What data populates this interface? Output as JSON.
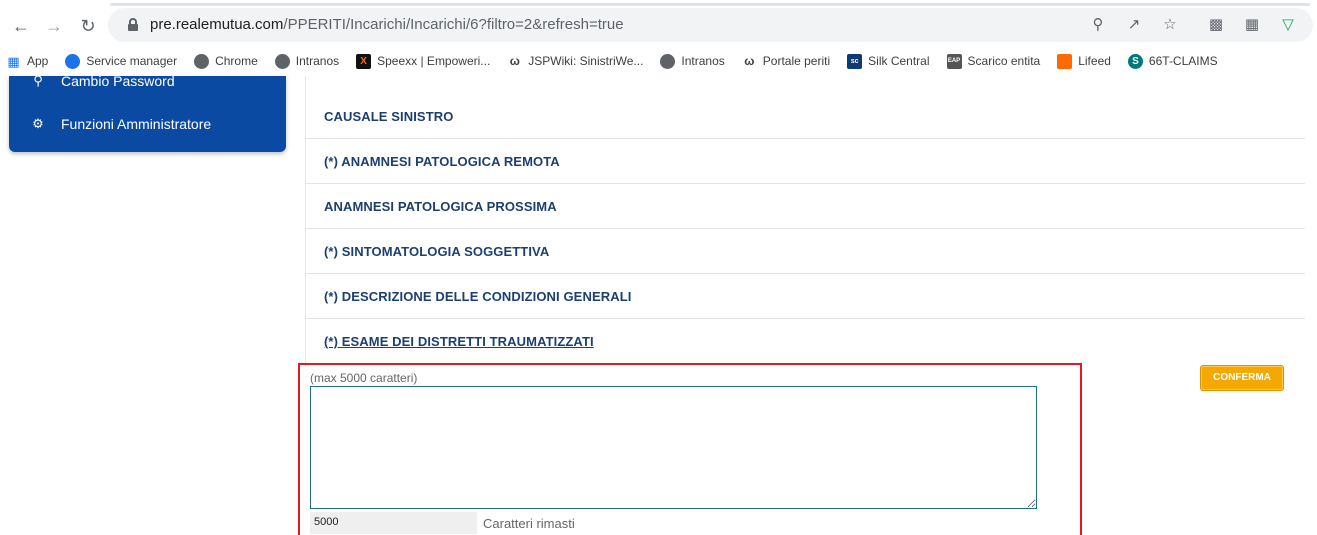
{
  "browser": {
    "url_domain": "pre.realemutua.com",
    "url_path": "/PPERITI/Incarichi/Incarichi/6?filtro=2&refresh=true",
    "icons": [
      "back-icon",
      "forward-icon",
      "reload-icon",
      "lock-icon",
      "zoom-icon",
      "share-icon",
      "star-icon",
      "qr-icon",
      "extension-icon",
      "vpn-icon"
    ]
  },
  "bookmarks": [
    {
      "label": "App",
      "icon": "apps-grid-icon"
    },
    {
      "label": "Service manager",
      "icon": "service-manager-icon"
    },
    {
      "label": "Chrome",
      "icon": "globe-icon"
    },
    {
      "label": "Intranos",
      "icon": "globe-icon"
    },
    {
      "label": "Speexx | Empoweri...",
      "icon": "speexx-icon"
    },
    {
      "label": "JSPWiki: SinistriWe...",
      "icon": "wiki-icon"
    },
    {
      "label": "Intranos",
      "icon": "globe-icon"
    },
    {
      "label": "Portale periti",
      "icon": "wiki-icon"
    },
    {
      "label": "Silk Central",
      "icon": "silk-central-icon"
    },
    {
      "label": "Scarico entita",
      "icon": "eap-icon"
    },
    {
      "label": "Lifeed",
      "icon": "lifeed-icon"
    },
    {
      "label": "66T-CLAIMS",
      "icon": "sharepoint-icon"
    }
  ],
  "sidebar": {
    "items": [
      {
        "label": "Cambio Password",
        "icon": "key-icon"
      },
      {
        "label": "Funzioni Amministratore",
        "icon": "gear-icon"
      }
    ]
  },
  "sections": [
    "CAUSALE SINISTRO",
    "(*) ANAMNESI PATOLOGICA REMOTA",
    "ANAMNESI PATOLOGICA PROSSIMA",
    "(*) SINTOMATOLOGIA SOGGETTIVA",
    "(*) DESCRIZIONE DELLE CONDIZIONI GENERALI",
    "(*) ESAME DEI DISTRETTI TRAUMATIZZATI"
  ],
  "editor": {
    "max_hint": "(max 5000 caratteri)",
    "value": "",
    "remaining": "5000",
    "remaining_label": "Caratteri rimasti"
  },
  "confirm_label": "CONFERMA",
  "colors": {
    "sidebar": "#0b4aa2",
    "section_text": "#1c3f73",
    "highlight": "#e01b24",
    "confirm": "#f5a800"
  }
}
